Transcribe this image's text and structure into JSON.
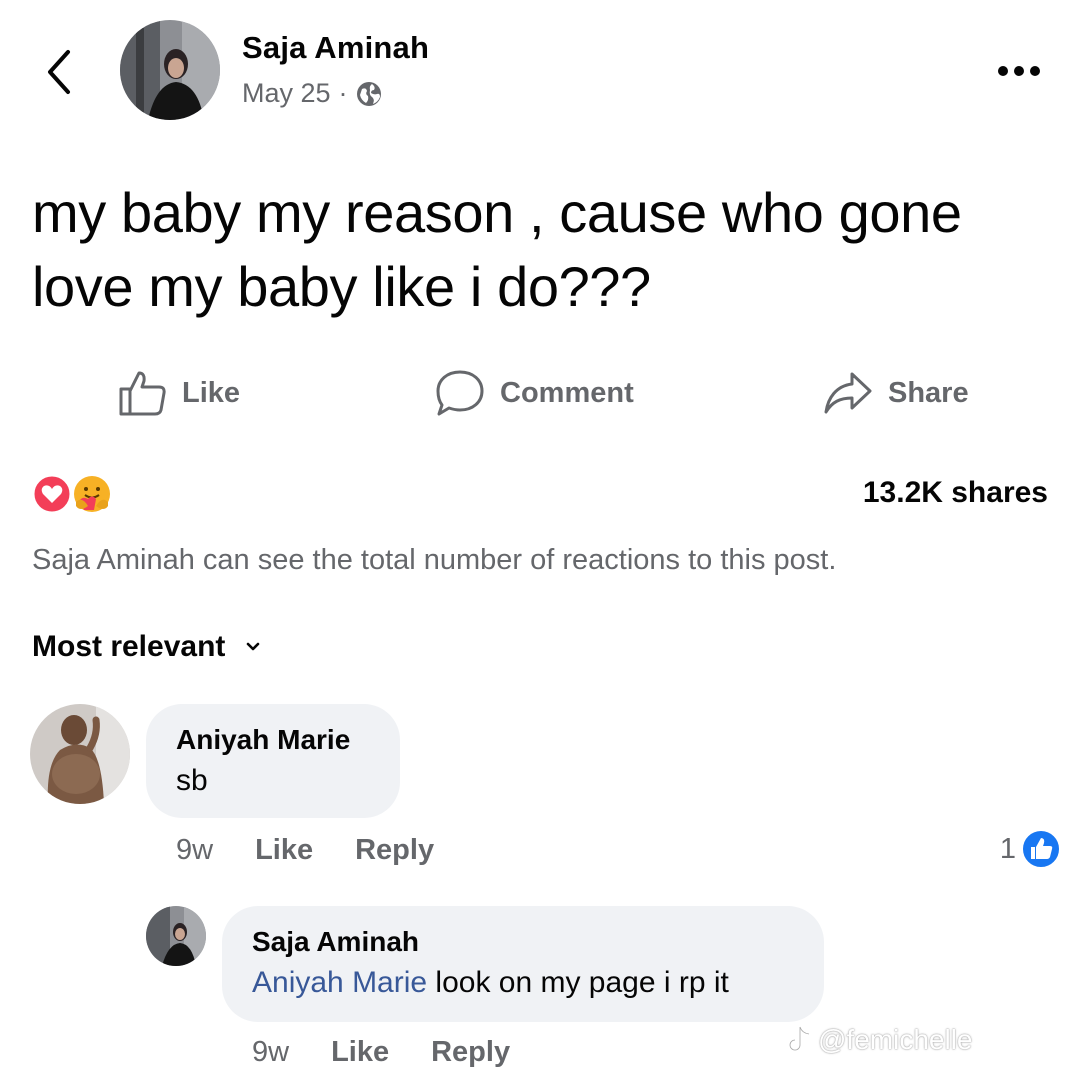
{
  "header": {
    "author_name": "Saja Aminah",
    "date": "May 25",
    "separator": "·",
    "privacy_icon": "globe-icon",
    "back_icon": "chevron-left-icon",
    "more_icon": "more-horizontal-icon"
  },
  "post": {
    "text": "my baby my reason , cause who gone love my baby like i do???"
  },
  "actions": {
    "like_label": "Like",
    "comment_label": "Comment",
    "share_label": "Share"
  },
  "reactions": {
    "icons": [
      "love-reaction-icon",
      "care-reaction-icon"
    ],
    "shares_text": "13.2K shares",
    "notice": "Saja Aminah can see the total number of reactions to this post."
  },
  "comments_sort": {
    "label": "Most relevant",
    "icon": "chevron-down-icon"
  },
  "comments": [
    {
      "author": "Aniyah Marie",
      "text": "sb",
      "time": "9w",
      "like_label": "Like",
      "reply_label": "Reply",
      "like_count": "1"
    }
  ],
  "replies": [
    {
      "author": "Saja Aminah",
      "mention": "Aniyah Marie",
      "text": " look on my page i rp it",
      "time": "9w",
      "like_label": "Like",
      "reply_label": "Reply"
    }
  ],
  "watermark": {
    "text": "@femichelle",
    "icon": "tiktok-icon"
  },
  "colors": {
    "secondary_text": "#65676b",
    "bubble": "#f0f2f5",
    "mention": "#385898",
    "like_blue": "#1877f2",
    "love_red": "#f33e58",
    "care_yellow": "#f7b125"
  }
}
